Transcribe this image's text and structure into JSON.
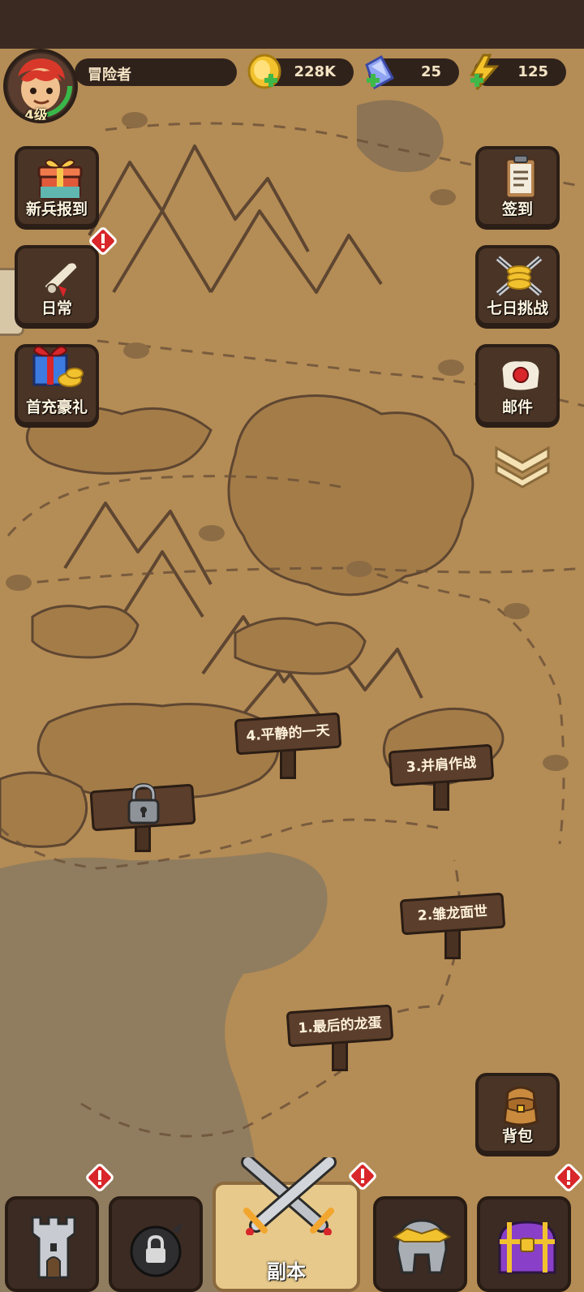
{
  "player": {
    "name": "冒险者",
    "level": "4级",
    "avatar_icon": "red-hair-hero-avatar",
    "xp_fraction": 0.75
  },
  "resources": [
    {
      "name": "gold",
      "value": "228K",
      "icon": "gold-coin-plus-icon"
    },
    {
      "name": "gems",
      "value": "25",
      "icon": "blue-gem-plus-icon"
    },
    {
      "name": "energy",
      "value": "125",
      "icon": "lightning-plus-icon"
    }
  ],
  "left_menu": [
    {
      "label": "新兵报到",
      "icon": "gift-box-icon",
      "alert": false
    },
    {
      "label": "日常",
      "icon": "scroll-icon",
      "alert": true
    },
    {
      "label": "首充豪礼",
      "icon": "gift-pile-icon",
      "alert": false
    }
  ],
  "right_menu": [
    {
      "label": "签到",
      "icon": "clipboard-icon"
    },
    {
      "label": "七日挑战",
      "icon": "crossed-swords-coins-icon"
    },
    {
      "label": "邮件",
      "icon": "sealed-letter-icon"
    },
    {
      "label": "背包",
      "icon": "backpack-icon"
    }
  ],
  "stages": [
    {
      "label": "1.最后的龙蛋",
      "locked": false
    },
    {
      "label": "2.雏龙面世",
      "locked": false
    },
    {
      "label": "3.并肩作战",
      "locked": false
    },
    {
      "label": "4.平静的一天",
      "locked": false
    },
    {
      "label": "",
      "locked": true,
      "icon": "padlock-icon"
    }
  ],
  "tabs": [
    {
      "icon": "tower-icon",
      "alert": true
    },
    {
      "icon": "locked-bomb-icon",
      "alert": false
    },
    {
      "label": "副本",
      "icon": "crossed-swords-icon",
      "alert": true,
      "active": true
    },
    {
      "icon": "helmet-icon",
      "alert": false
    },
    {
      "icon": "treasure-chest-icon",
      "alert": true
    }
  ],
  "colors": {
    "map": "#b48c55",
    "wood": "#5b3e2b",
    "alert_red": "#d8262a",
    "active_tab": "#e7c98b"
  }
}
